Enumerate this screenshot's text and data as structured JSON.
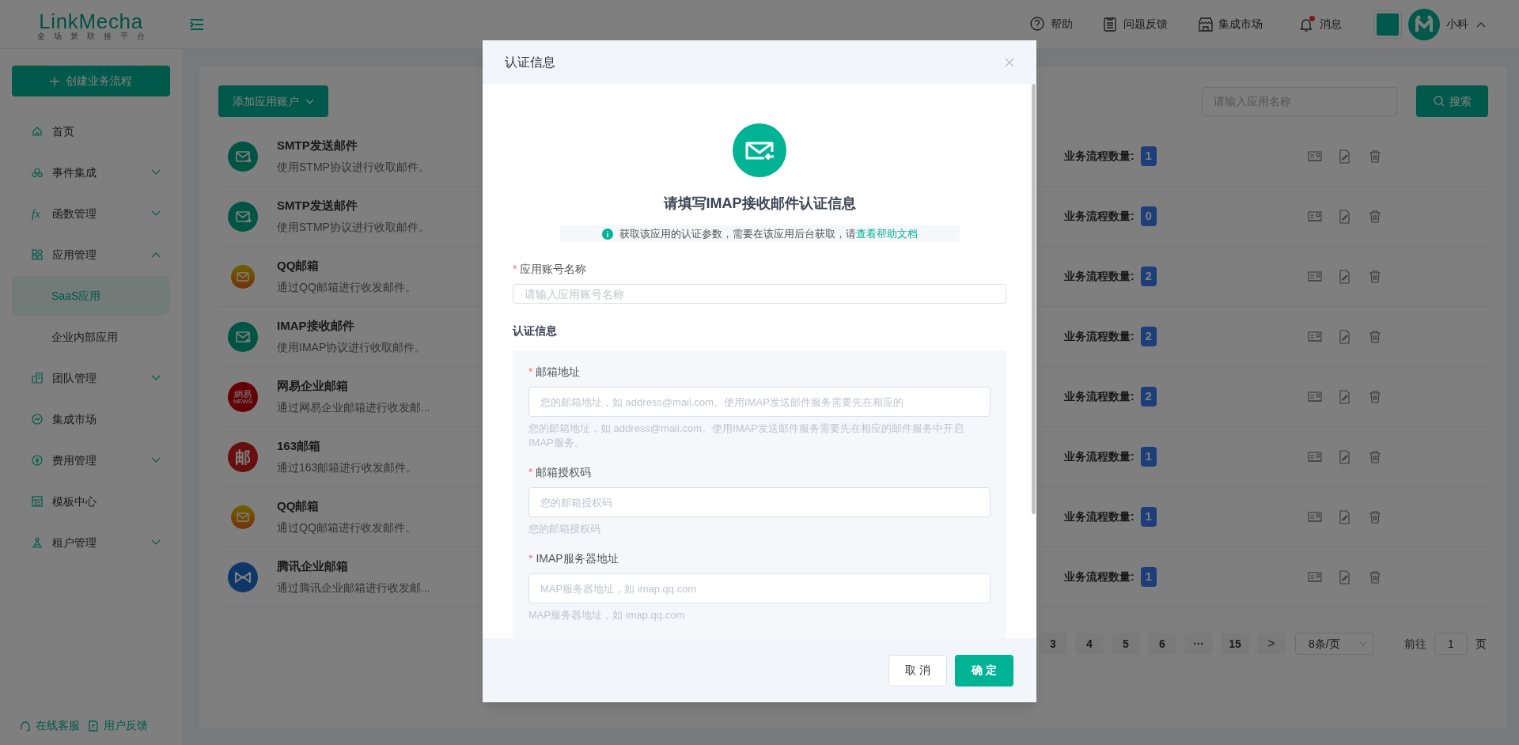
{
  "header": {
    "logo": "LinkMecha",
    "tagline": "全场景联接平台",
    "actions": [
      {
        "label": "帮助",
        "notification": false
      },
      {
        "label": "问题反馈",
        "notification": false
      },
      {
        "label": "集成市场",
        "notification": false
      },
      {
        "label": "消息",
        "notification": true
      }
    ],
    "user": {
      "name": "小科",
      "expanded": true
    }
  },
  "sidebar": {
    "create_button": "创建业务流程",
    "items": [
      {
        "kind": "link",
        "label": "首页",
        "selected": false
      },
      {
        "kind": "group",
        "label": "事件集成",
        "expanded": false,
        "selected": false
      },
      {
        "kind": "group",
        "label": "函数管理",
        "icon_text": "fx",
        "expanded": false,
        "selected": false
      },
      {
        "kind": "group",
        "label": "应用管理",
        "expanded": true,
        "selected": false,
        "children": [
          {
            "label": "SaaS应用",
            "selected": true
          },
          {
            "label": "企业内部应用",
            "selected": false
          }
        ]
      },
      {
        "kind": "group",
        "label": "团队管理",
        "expanded": false,
        "selected": false
      },
      {
        "kind": "link",
        "label": "集成市场",
        "selected": false
      },
      {
        "kind": "group",
        "label": "费用管理",
        "expanded": false,
        "selected": false
      },
      {
        "kind": "link",
        "label": "模板中心",
        "selected": false
      },
      {
        "kind": "group",
        "label": "租户管理",
        "expanded": false,
        "selected": false
      }
    ],
    "footer_links": [
      "在线客服",
      "用户反馈"
    ]
  },
  "toolbar": {
    "add_button": "添加应用账户",
    "search_placeholder": "请输入应用名称",
    "search_button": "搜索"
  },
  "apps": [
    {
      "kind": "send",
      "name": "SMTP发送邮件",
      "description": "使用STMP协议进行收取邮件。",
      "count_label": "业务流程数量:",
      "count": "1"
    },
    {
      "kind": "send",
      "name": "SMTP发送邮件",
      "description": "使用STMP协议进行收取邮件。",
      "count_label": "业务流程数量:",
      "count": "0"
    },
    {
      "kind": "qq",
      "name": "QQ邮箱",
      "description": "通过QQ邮箱进行收发邮件。",
      "count_label": "业务流程数量:",
      "count": "2"
    },
    {
      "kind": "receive",
      "name": "IMAP接收邮件",
      "description": "使用IMAP协议进行收取邮件。",
      "count_label": "业务流程数量:",
      "count": "2"
    },
    {
      "kind": "netease",
      "logo_text": "網易",
      "logo_subtext": "NEWS",
      "name": "网易企业邮箱",
      "description": "通过网易企业邮箱进行收发邮...",
      "count_label": "业务流程数量:",
      "count": "2"
    },
    {
      "kind": "postal",
      "logo_text": "邮",
      "name": "163邮箱",
      "description": "通过163邮箱进行收发邮件。",
      "count_label": "业务流程数量:",
      "count": "1"
    },
    {
      "kind": "qq",
      "name": "QQ邮箱",
      "description": "通过QQ邮箱进行收发邮件。",
      "count_label": "业务流程数量:",
      "count": "1"
    },
    {
      "kind": "tencent",
      "name": "腾讯企业邮箱",
      "description": "通过腾讯企业邮箱进行收发邮...",
      "count_label": "业务流程数量:",
      "count": "1"
    }
  ],
  "pagination": {
    "pages": [
      "3",
      "4",
      "5",
      "6",
      "···",
      "15"
    ],
    "next": ">",
    "page_size": "8条/页",
    "goto_label": "前往",
    "goto_value": "1",
    "goto_suffix": "页"
  },
  "modal": {
    "title": "认证信息",
    "heading": "请填写IMAP接收邮件认证信息",
    "info_text": "获取该应用的认证参数，需要在该应用后台获取，请",
    "info_link": "查看帮助文档",
    "account_field": {
      "label": "应用账号名称",
      "required": true,
      "placeholder": "请输入应用账号名称"
    },
    "section_title": "认证信息",
    "required_mark": "*",
    "fields": [
      {
        "label": "邮箱地址",
        "required": true,
        "placeholder": "您的邮箱地址，如 address@mail.com。使用IMAP发送邮件服务需要先在相应的",
        "help": "您的邮箱地址，如 address@mail.com。使用IMAP发送邮件服务需要先在相应的邮件服务中开启IMAP服务。"
      },
      {
        "label": "邮箱授权码",
        "required": true,
        "placeholder": "您的邮箱授权码",
        "help": "您的邮箱授权码"
      },
      {
        "label": "IMAP服务器地址",
        "required": true,
        "placeholder": "MAP服务器地址，如 imap.qq.com",
        "help": "MAP服务器地址，如 imap.qq.com"
      }
    ],
    "cancel_button": "取 消",
    "confirm_button": "确 定"
  }
}
